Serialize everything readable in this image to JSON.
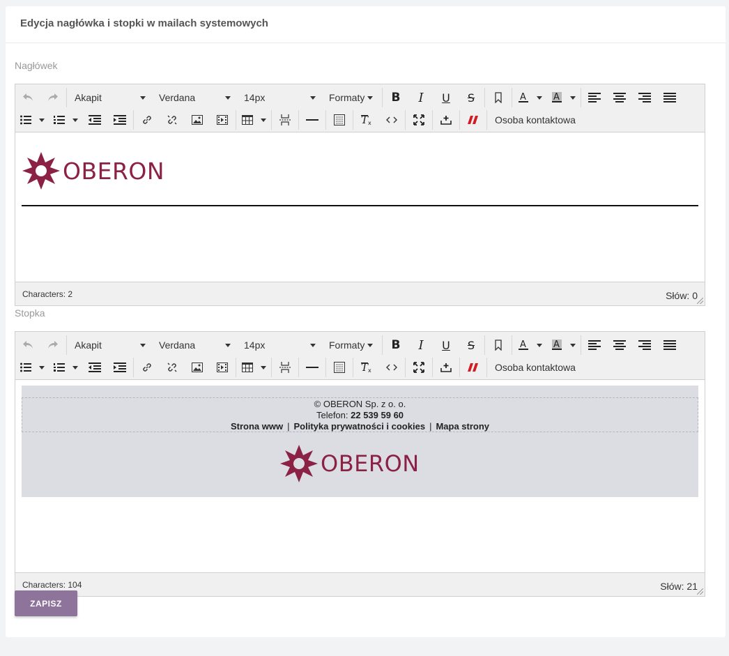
{
  "page_title": "Edycja nagłówka i stopki w mailach systemowych",
  "toolbar": {
    "block_format": "Akapit",
    "font_family": "Verdana",
    "font_size": "14px",
    "formats": "Formaty",
    "contact_person": "Osoba kontaktowa"
  },
  "header_editor": {
    "label": "Nagłówek",
    "logo_text": "OBERON",
    "characters": "Characters: 2",
    "words": "Słów: 0"
  },
  "footer_editor": {
    "label": "Stopka",
    "copyright": "© OBERON Sp. z o. o.",
    "phone_label": "Telefon: ",
    "phone_number": "22 539 59 60",
    "links": [
      "Strona www",
      "Polityka prywatności i cookies",
      "Mapa strony"
    ],
    "link_separator": "|",
    "logo_text": "OBERON",
    "characters": "Characters: 104",
    "words": "Słów: 21"
  },
  "save_button": "ZAPISZ",
  "colors": {
    "brand": "#8b2246",
    "button": "#8e739b",
    "footer_bg": "#dcdde3"
  },
  "icons": [
    "undo-icon",
    "redo-icon",
    "bold-icon",
    "italic-icon",
    "underline-icon",
    "strikethrough-icon",
    "bookmark-icon",
    "text-color-icon",
    "background-color-icon",
    "align-left-icon",
    "align-center-icon",
    "align-right-icon",
    "justify-icon",
    "bullet-list-icon",
    "numbered-list-icon",
    "outdent-icon",
    "indent-icon",
    "link-icon",
    "unlink-icon",
    "image-icon",
    "media-icon",
    "table-icon",
    "page-break-icon",
    "horizontal-rule-icon",
    "visual-blocks-icon",
    "clear-formatting-icon",
    "code-icon",
    "fullscreen-icon",
    "insert-icon",
    "template-icon"
  ]
}
